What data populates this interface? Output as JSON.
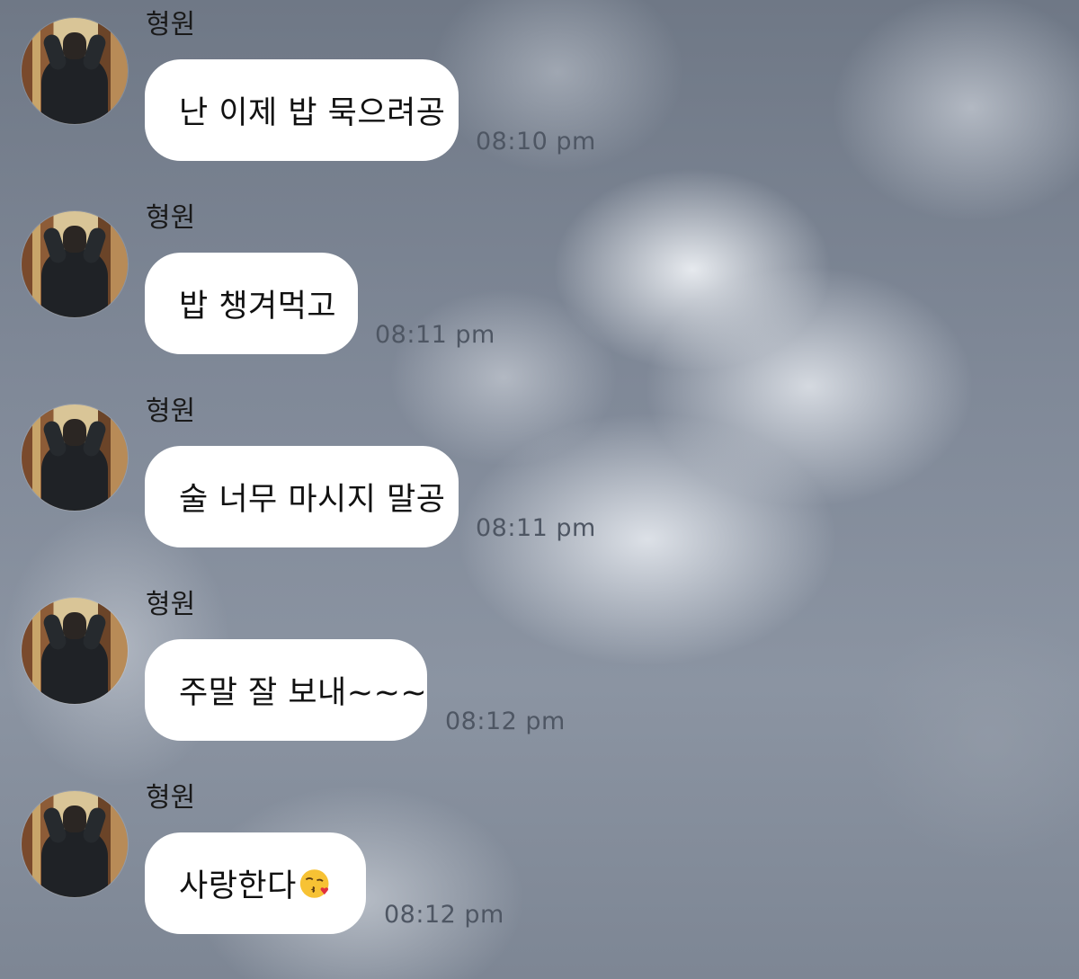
{
  "messages": [
    {
      "sender": "형원",
      "text": "난 이제 밥 묵으려공",
      "time": "08:10 pm",
      "emoji": ""
    },
    {
      "sender": "형원",
      "text": "밥 챙겨먹고",
      "time": "08:11 pm",
      "emoji": ""
    },
    {
      "sender": "형원",
      "text": "술 너무 마시지 말공",
      "time": "08:11 pm",
      "emoji": ""
    },
    {
      "sender": "형원",
      "text": "주말 잘 보내~~~",
      "time": "08:12 pm",
      "emoji": ""
    },
    {
      "sender": "형원",
      "text": "사랑한다",
      "time": "08:12 pm",
      "emoji": "face-blowing-kiss-icon"
    }
  ]
}
